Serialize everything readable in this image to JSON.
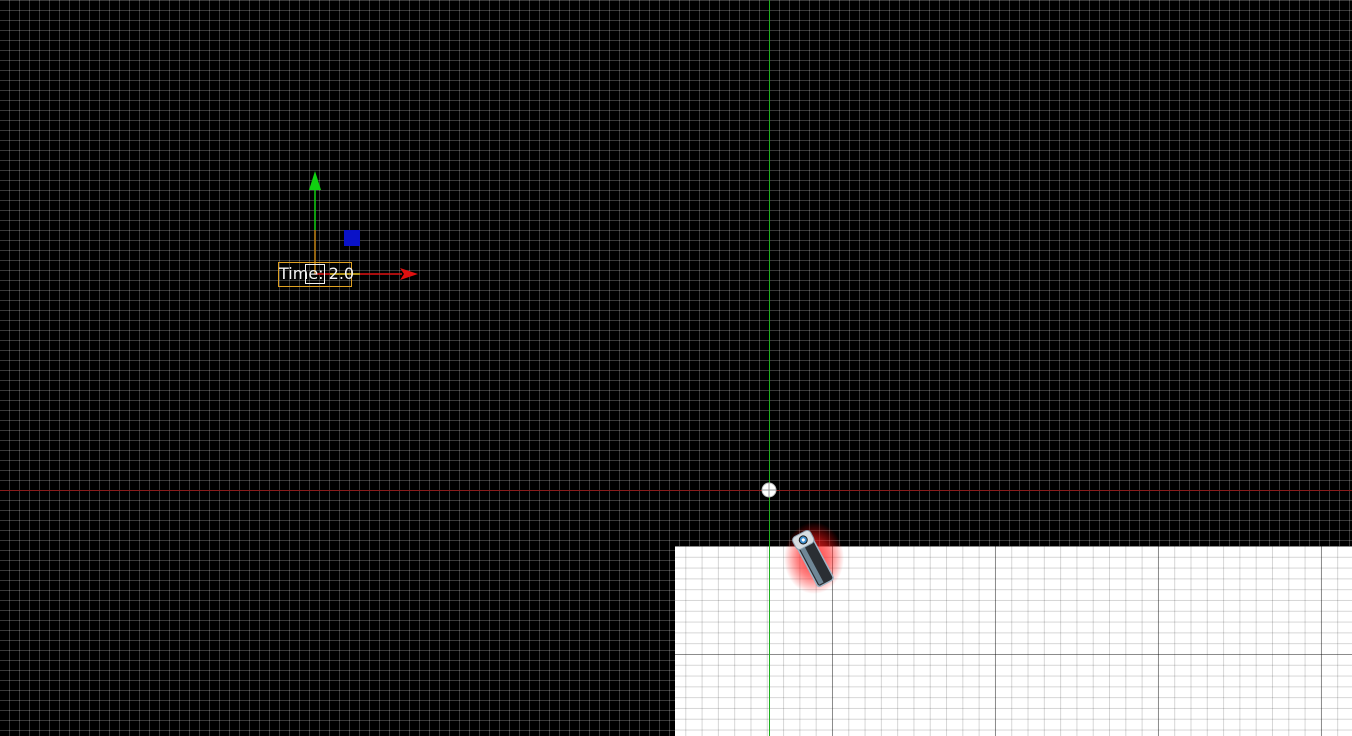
{
  "scene": {
    "time_label": "Time: 2.0",
    "colors": {
      "background": "#000000",
      "grid": "#383838",
      "axis_x": "#8a1a1a",
      "axis_y": "#1fb01f",
      "gizmo_x": "#e01010",
      "gizmo_y": "#10d010",
      "gizmo_plane_handle": "#0a12c8",
      "selection_frame": "#e0a020",
      "screen_rect": "#ffffff",
      "camera_glow": "#ff2020"
    },
    "icons": {
      "move_gizmo": "move-gizmo-icon",
      "origin": "origin-crosshair-icon",
      "camera": "camera-node-icon"
    }
  }
}
